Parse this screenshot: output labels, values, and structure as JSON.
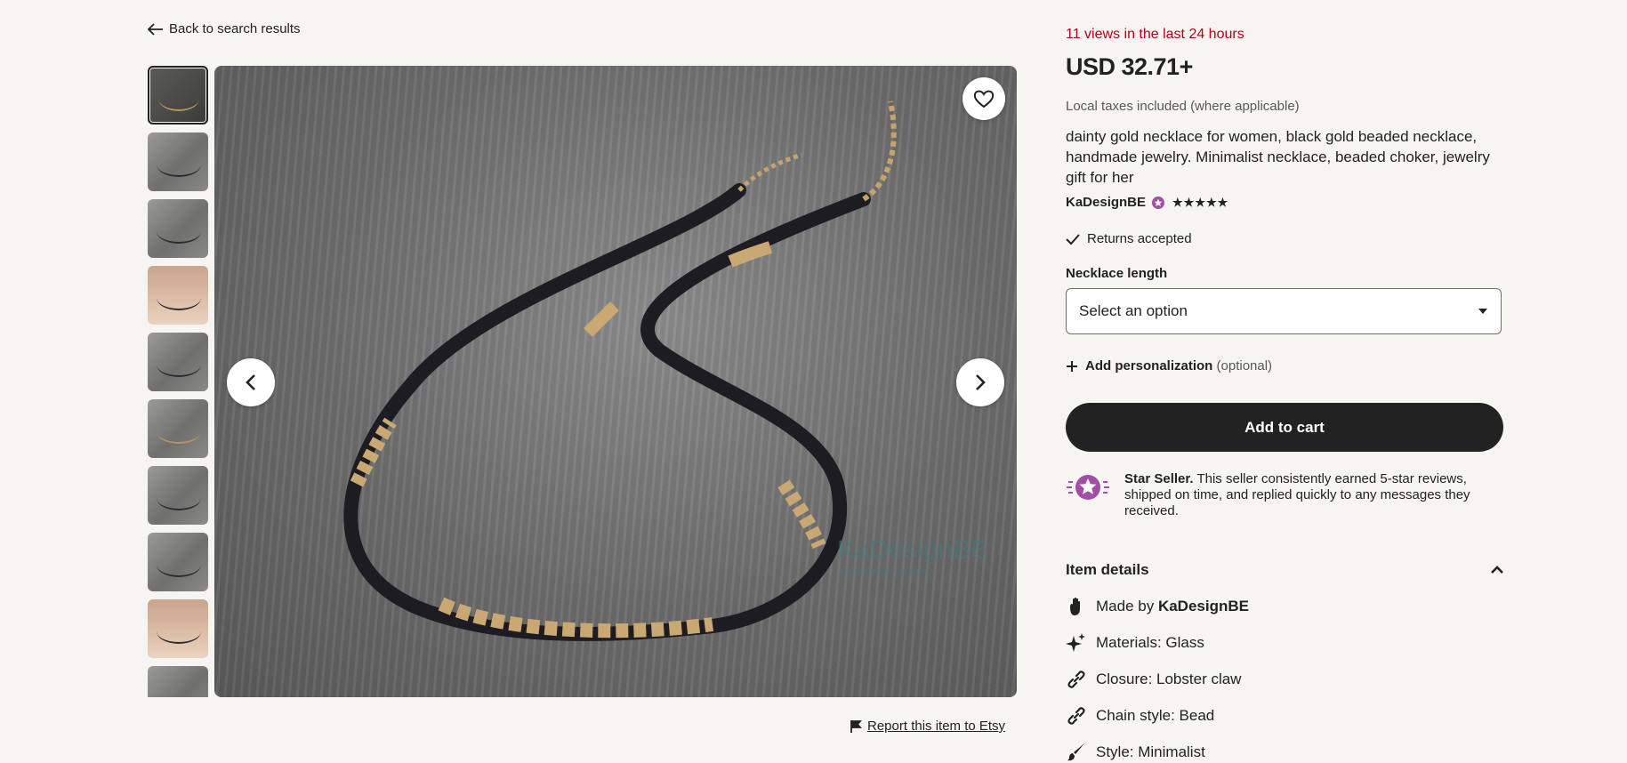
{
  "nav": {
    "back_label": "Back to search results"
  },
  "gallery": {
    "thumbnail_count": 10,
    "selected_index": 0
  },
  "report": {
    "label": "Report this item to Etsy"
  },
  "product": {
    "views_notice": "11 views in the last 24 hours",
    "price": "USD 32.71+",
    "tax_note": "Local taxes included (where applicable)",
    "title": "dainty gold necklace for women, black gold beaded necklace, handmade jewelry. Minimalist necklace, beaded choker, jewelry gift for her",
    "shop_name": "KaDesignBE",
    "rating_stars": "★★★★★",
    "returns": "Returns accepted"
  },
  "options": {
    "label": "Necklace length",
    "selected": "Select an option"
  },
  "personalization": {
    "label": "Add personalization",
    "optional": "(optional)"
  },
  "cart": {
    "label": "Add to cart"
  },
  "star_seller": {
    "title": "Star Seller.",
    "text": "This seller consistently earned 5-star reviews, shipped on time, and replied quickly to any messages they received."
  },
  "item_details": {
    "heading": "Item details",
    "made_by_prefix": "Made by",
    "made_by_shop": "KaDesignBE",
    "materials": "Materials: Glass",
    "closure": "Closure: Lobster claw",
    "chain_style": "Chain style: Bead",
    "style": "Style: Minimalist"
  },
  "image_watermark": {
    "brand": "KaDesignBE",
    "sub": "Handmade Jewelry"
  },
  "colors": {
    "accent_red": "#b3001b",
    "cart_bg": "#222222",
    "star_seller_purple": "#a34ea5"
  }
}
